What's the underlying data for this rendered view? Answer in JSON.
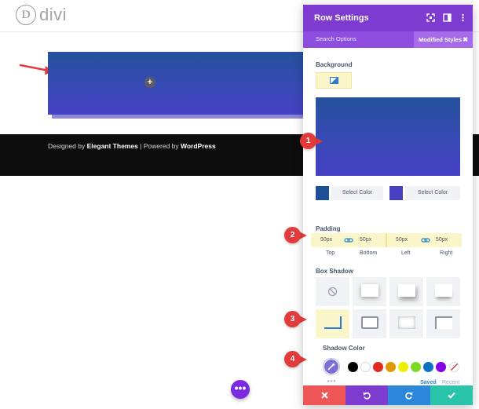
{
  "site": {
    "logo_letter": "D",
    "logo_text": "divi",
    "add_symbol": "+",
    "footer": {
      "prefix": "Designed by ",
      "elegant": "Elegant Themes",
      "middle": " | Powered by ",
      "wordpress": "WordPress"
    },
    "dots_symbol": "•••"
  },
  "panel": {
    "title": "Row Settings",
    "search_options": "Search Options",
    "modified_styles": "Modified Styles",
    "modified_close": "✖",
    "background_label": "Background",
    "gradient": {
      "top_color": "#25529c",
      "bottom_color": "#4640c4"
    },
    "color_stops": [
      {
        "color": "#1f4f96",
        "label": "Select Color"
      },
      {
        "color": "#4840c2",
        "label": "Select Color"
      }
    ],
    "padding_label": "Padding",
    "padding": [
      {
        "value": "50px",
        "label": "Top"
      },
      {
        "value": "50px",
        "label": "Bottom"
      },
      {
        "value": "50px",
        "label": "Left"
      },
      {
        "value": "50px",
        "label": "Right"
      }
    ],
    "box_shadow_label": "Box Shadow",
    "shadow_color_label": "Shadow Color",
    "picker_dots": "•••",
    "palette": [
      "#000000",
      "#ffffff",
      "#e02b20",
      "#e09900",
      "#edf000",
      "#7cda24",
      "#0c71c3",
      "#8300e9"
    ],
    "palette_tabs": {
      "saved": "Saved",
      "recent": "Recent"
    }
  },
  "callouts": [
    "1",
    "2",
    "3",
    "4"
  ],
  "colors": {
    "header_purple": "#7e3bd0",
    "subbar_purple": "#8e4fe0",
    "highlight_yellow": "#fbf6c9",
    "cancel_red": "#ef5555",
    "undo_purple": "#7e3bd0",
    "redo_blue": "#2b87da",
    "save_green": "#29c4a9"
  }
}
